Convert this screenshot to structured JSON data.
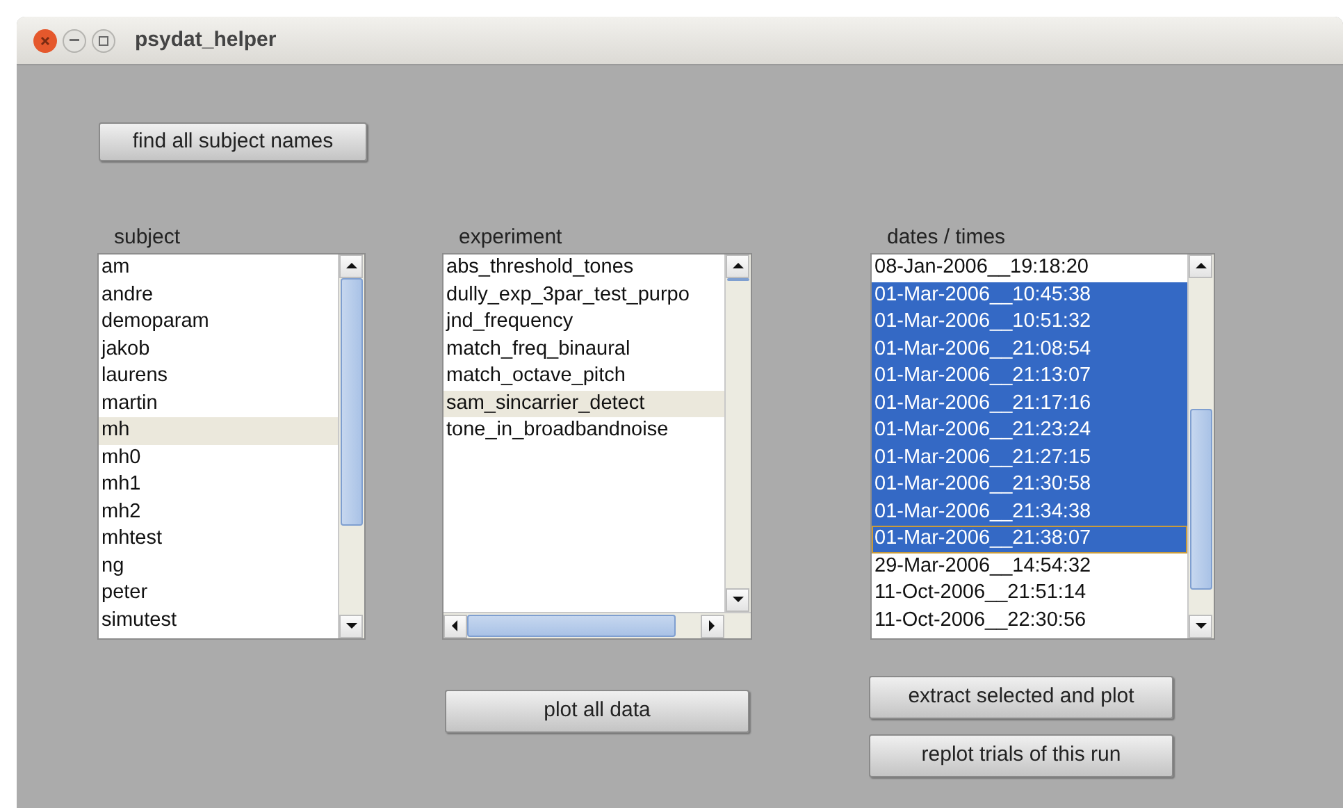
{
  "window": {
    "title": "psydat_helper"
  },
  "find_button": {
    "label": "find all subject names"
  },
  "subject": {
    "label": "subject",
    "items": [
      {
        "text": "am",
        "selected": false
      },
      {
        "text": "andre",
        "selected": false
      },
      {
        "text": "demoparam",
        "selected": false
      },
      {
        "text": "jakob",
        "selected": false
      },
      {
        "text": "laurens",
        "selected": false
      },
      {
        "text": "martin",
        "selected": false
      },
      {
        "text": "mh",
        "selected": true
      },
      {
        "text": "mh0",
        "selected": false
      },
      {
        "text": "mh1",
        "selected": false
      },
      {
        "text": "mh2",
        "selected": false
      },
      {
        "text": "mhtest",
        "selected": false
      },
      {
        "text": "ng",
        "selected": false
      },
      {
        "text": "peter",
        "selected": false
      },
      {
        "text": "simutest",
        "selected": false
      }
    ]
  },
  "experiment": {
    "label": "experiment",
    "items": [
      {
        "text": "abs_threshold_tones",
        "selected": false
      },
      {
        "text": "dully_exp_3par_test_purpo",
        "selected": false
      },
      {
        "text": "jnd_frequency",
        "selected": false
      },
      {
        "text": "match_freq_binaural",
        "selected": false
      },
      {
        "text": "match_octave_pitch",
        "selected": false
      },
      {
        "text": "sam_sincarrier_detect",
        "selected": true
      },
      {
        "text": "tone_in_broadbandnoise",
        "selected": false
      }
    ]
  },
  "dates": {
    "label": "dates / times",
    "items": [
      {
        "text": "08-Jan-2006__19:18:20",
        "selected": false,
        "focused": false
      },
      {
        "text": "01-Mar-2006__10:45:38",
        "selected": true,
        "focused": false
      },
      {
        "text": "01-Mar-2006__10:51:32",
        "selected": true,
        "focused": false
      },
      {
        "text": "01-Mar-2006__21:08:54",
        "selected": true,
        "focused": false
      },
      {
        "text": "01-Mar-2006__21:13:07",
        "selected": true,
        "focused": false
      },
      {
        "text": "01-Mar-2006__21:17:16",
        "selected": true,
        "focused": false
      },
      {
        "text": "01-Mar-2006__21:23:24",
        "selected": true,
        "focused": false
      },
      {
        "text": "01-Mar-2006__21:27:15",
        "selected": true,
        "focused": false
      },
      {
        "text": "01-Mar-2006__21:30:58",
        "selected": true,
        "focused": false
      },
      {
        "text": "01-Mar-2006__21:34:38",
        "selected": true,
        "focused": false
      },
      {
        "text": "01-Mar-2006__21:38:07",
        "selected": true,
        "focused": true
      },
      {
        "text": "29-Mar-2006__14:54:32",
        "selected": false,
        "focused": false
      },
      {
        "text": "11-Oct-2006__21:51:14",
        "selected": false,
        "focused": false
      },
      {
        "text": "11-Oct-2006__22:30:56",
        "selected": false,
        "focused": false
      }
    ]
  },
  "plot_button": {
    "label": "plot all data"
  },
  "extract_button": {
    "label": "extract selected and plot"
  },
  "replot_button": {
    "label": "replot trials of this run"
  }
}
